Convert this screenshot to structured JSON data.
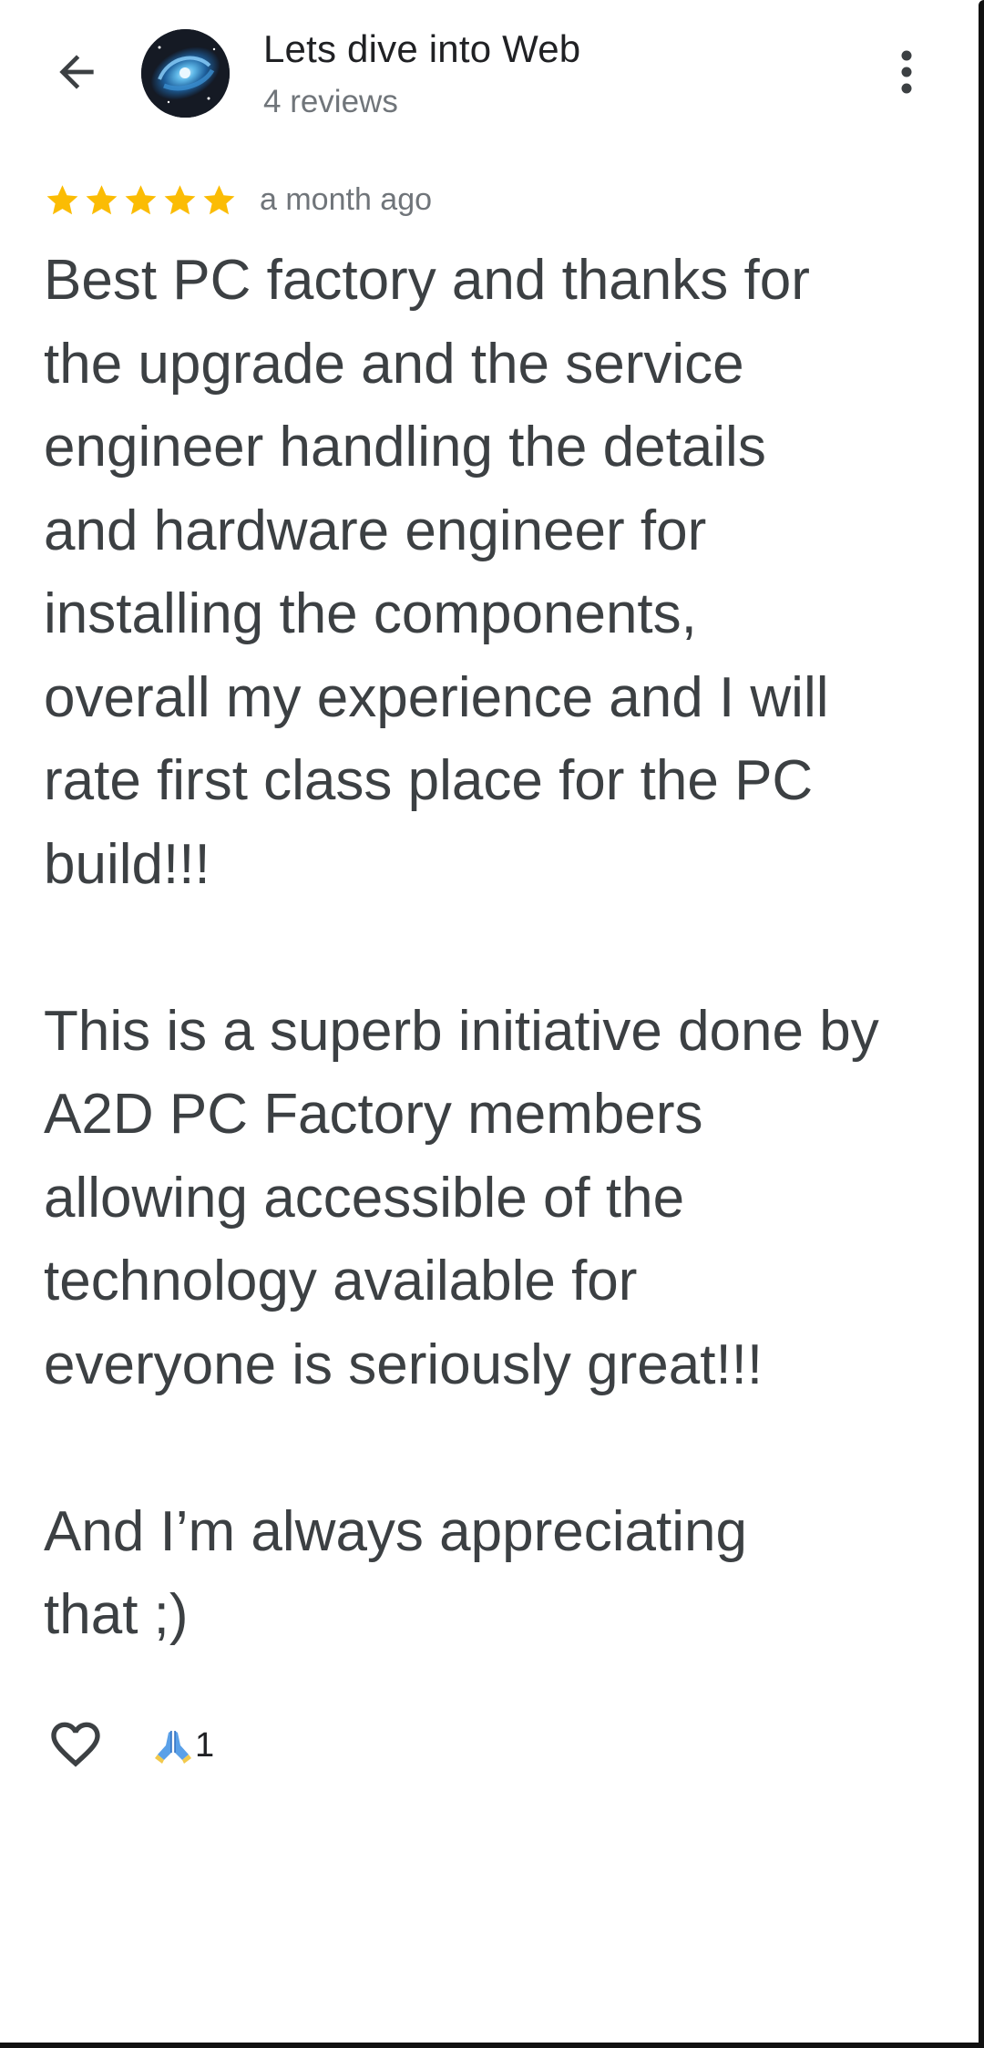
{
  "header": {
    "author_name": "Lets dive into Web",
    "review_count": "4 reviews",
    "back_icon": "arrow-back-icon",
    "more_icon": "more-vert-icon"
  },
  "rating": {
    "stars": 5,
    "max_stars": 5,
    "star_color": "#fbbc04",
    "date": "a month ago"
  },
  "review": {
    "paragraphs": [
      "Best PC factory and thanks for\nthe upgrade and the service\nengineer handling the details\nand hardware engineer for\ninstalling the components,\noverall my experience and I will\nrate first class place for the PC\nbuild!!!",
      "This is a superb initiative done by\nA2D PC Factory members\nallowing accessible of the\ntechnology available for\neveryone is seriously great!!!",
      "And I’m always appreciating\nthat ;)"
    ]
  },
  "reactions": {
    "like_icon": "heart-outline-icon",
    "emoji": "🙏",
    "count": "1"
  }
}
